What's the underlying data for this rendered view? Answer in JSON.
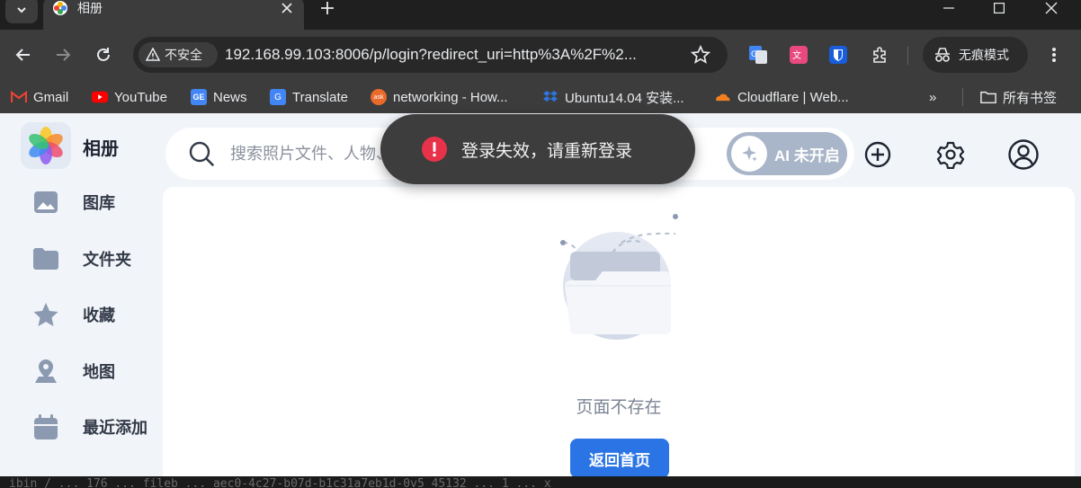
{
  "browser": {
    "tab": {
      "title": "相册"
    },
    "omnibox": {
      "security_label": "不安全",
      "url": "192.168.99.103:8006/p/login?redirect_uri=http%3A%2F%2..."
    },
    "incognito_label": "无痕模式",
    "bookmarks": [
      {
        "label": "Gmail",
        "icon": "gmail-icon",
        "color": "#ea4335"
      },
      {
        "label": "YouTube",
        "icon": "youtube-icon",
        "color": "#ff0000"
      },
      {
        "label": "News",
        "icon": "news-icon",
        "color": "#4285f4"
      },
      {
        "label": "Translate",
        "icon": "translate-icon",
        "color": "#4285f4"
      },
      {
        "label": "networking - How...",
        "icon": "ask-icon",
        "color": "#e96a2a"
      },
      {
        "label": "Ubuntu14.04 安装...",
        "icon": "dropbox-icon",
        "color": "#2e74dc"
      },
      {
        "label": "Cloudflare | Web...",
        "icon": "cloudflare-icon",
        "color": "#f38020"
      }
    ],
    "bookmarks_more": "»",
    "all_bookmarks_label": "所有书签"
  },
  "app": {
    "title": "相册",
    "sidebar": [
      {
        "label": "图库",
        "icon": "image-icon"
      },
      {
        "label": "文件夹",
        "icon": "folder-icon"
      },
      {
        "label": "收藏",
        "icon": "star-icon"
      },
      {
        "label": "地图",
        "icon": "map-pin-icon"
      },
      {
        "label": "最近添加",
        "icon": "calendar-icon"
      }
    ],
    "search": {
      "placeholder": "搜索照片文件、人物、地点"
    },
    "ai_toggle_label": "AI 未开启",
    "empty": {
      "message": "页面不存在",
      "button_label": "返回首页"
    },
    "toast": {
      "message": "登录失效，请重新登录"
    }
  },
  "terminal_fragment": "ibin / ... 176 ... fileb ... aec0-4c27-b07d-b1c31a7eb1d-0v5 45132 ... 1 ... x",
  "colors": {
    "accent": "#2a74e5",
    "toast_error": "#e8324a",
    "sidebar_icon": "#8b99b1",
    "ai_toggle_off": "#a9b5c8"
  }
}
